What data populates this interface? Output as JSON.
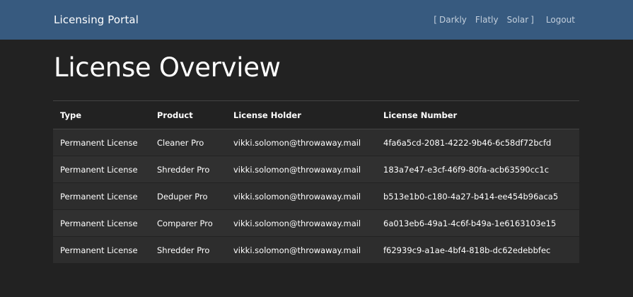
{
  "navbar": {
    "brand": "Licensing Portal",
    "theme_open": "[",
    "themes": [
      "Darkly",
      "Flatly",
      "Solar"
    ],
    "theme_close": "]",
    "logout": "Logout"
  },
  "page": {
    "title": "License Overview"
  },
  "table": {
    "headers": [
      "Type",
      "Product",
      "License Holder",
      "License Number"
    ],
    "rows": [
      [
        "Permanent License",
        "Cleaner Pro",
        "vikki.solomon@throwaway.mail",
        "4fa6a5cd-2081-4222-9b46-6c58df72bcfd"
      ],
      [
        "Permanent License",
        "Shredder Pro",
        "vikki.solomon@throwaway.mail",
        "183a7e47-e3cf-46f9-80fa-acb63590cc1c"
      ],
      [
        "Permanent License",
        "Deduper Pro",
        "vikki.solomon@throwaway.mail",
        "b513e1b0-c180-4a27-b414-ee454b96aca5"
      ],
      [
        "Permanent License",
        "Comparer Pro",
        "vikki.solomon@throwaway.mail",
        "6a013eb6-49a1-4c6f-b49a-1e6163103e15"
      ],
      [
        "Permanent License",
        "Shredder Pro",
        "vikki.solomon@throwaway.mail",
        "f62939c9-a1ae-4bf4-818b-dc62edebbfec"
      ]
    ]
  },
  "colors": {
    "navbar": "#375a7f",
    "background": "#222222",
    "row": "#2d2d2d"
  }
}
